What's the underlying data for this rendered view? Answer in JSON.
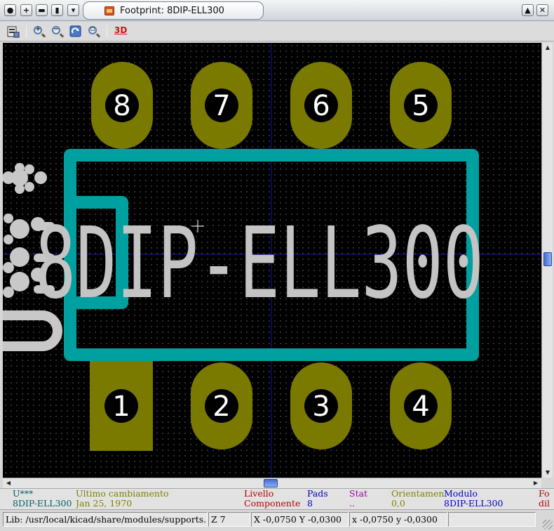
{
  "window": {
    "title": "Footprint: 8DIP-ELL300"
  },
  "toolbar": {
    "tools": [
      "select-footprint-icon",
      "zoom-in-icon",
      "zoom-out-icon",
      "redraw-icon",
      "zoom-fit-icon",
      "3d-view-icon"
    ],
    "label_3d": "3D"
  },
  "canvas": {
    "reference_text": "8DIP-ELL300",
    "pads": [
      {
        "number": "8",
        "shape": "oval"
      },
      {
        "number": "7",
        "shape": "oval"
      },
      {
        "number": "6",
        "shape": "oval"
      },
      {
        "number": "5",
        "shape": "oval"
      },
      {
        "number": "1",
        "shape": "rect"
      },
      {
        "number": "2",
        "shape": "oval"
      },
      {
        "number": "3",
        "shape": "oval"
      },
      {
        "number": "4",
        "shape": "oval"
      }
    ],
    "colors": {
      "background": "#000000",
      "pad": "#7a7a00",
      "silkscreen": "#00a0a0",
      "text": "#c0c0c0",
      "axis": "#1010a0"
    }
  },
  "message_panel": {
    "reference": {
      "label": "U***",
      "value": "8DIP-ELL300",
      "color": "#006060"
    },
    "last_change": {
      "label": "Ultimo cambiamento",
      "value": "Jan 25, 1970",
      "color": "#808000"
    },
    "layer": {
      "label": "Livello",
      "value": "Componente",
      "color": "#b00000"
    },
    "pads": {
      "label": "Pads",
      "value": "8",
      "color": "#0000c0"
    },
    "stat": {
      "label": "Stat",
      "value": "..",
      "color": "#a000a0"
    },
    "orientation": {
      "label": "Orientamen",
      "value": "0,0",
      "color": "#808000"
    },
    "module": {
      "label": "Modulo",
      "value": "8DIP-ELL300",
      "color": "#0000c0"
    },
    "footprint": {
      "label": "Fo",
      "value": "dil",
      "color": "#b00000"
    }
  },
  "statusbar": {
    "lib": "Lib: /usr/local/kicad/share/modules/supports.",
    "zoom": "Z 7",
    "abs_coords": "X -0,0750  Y -0,0300",
    "rel_coords": "x -0,0750  y -0,0300"
  }
}
